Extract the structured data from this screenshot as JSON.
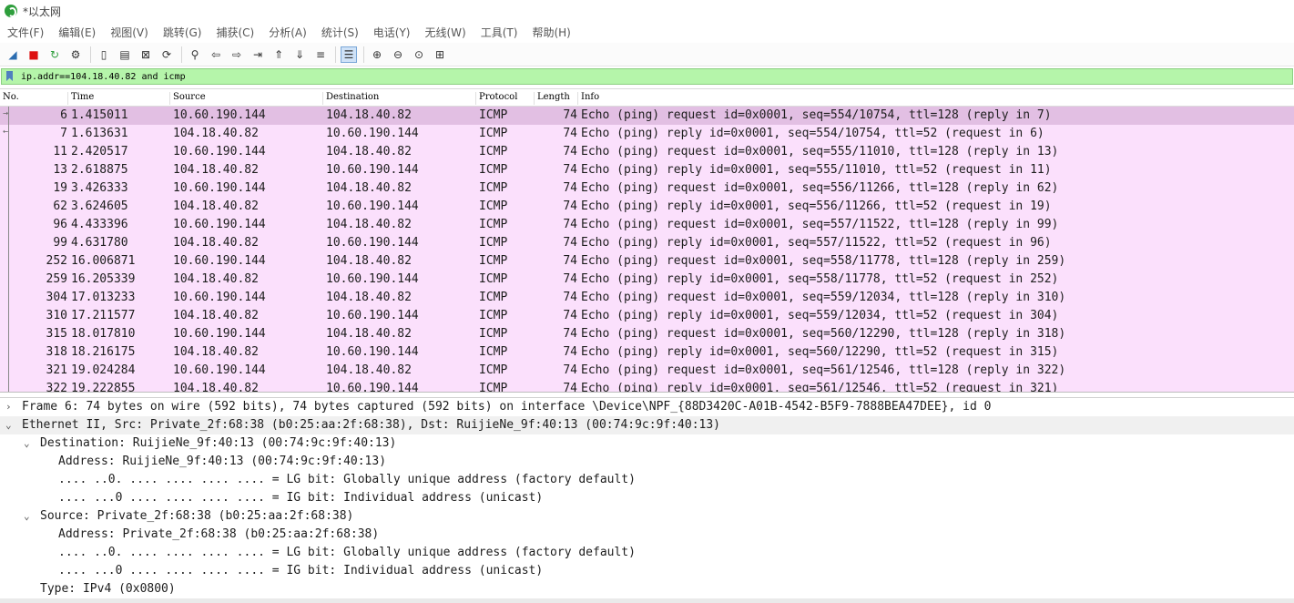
{
  "window": {
    "title": "*以太网"
  },
  "menubar": [
    "文件(F)",
    "编辑(E)",
    "视图(V)",
    "跳转(G)",
    "捕获(C)",
    "分析(A)",
    "统计(S)",
    "电话(Y)",
    "无线(W)",
    "工具(T)",
    "帮助(H)"
  ],
  "toolbar": {
    "icons": [
      "shark-fin-start-icon",
      "stop-icon",
      "restart-icon",
      "options-gear-icon",
      "open-file-icon",
      "save-file-icon",
      "close-file-icon",
      "reload-icon",
      "find-icon",
      "back-arrow-icon",
      "forward-arrow-icon",
      "go-to-packet-icon",
      "first-packet-icon",
      "last-packet-icon",
      "auto-scroll-icon",
      "colorize-icon",
      "zoom-in-icon",
      "zoom-out-icon",
      "zoom-normal-icon",
      "resize-columns-icon"
    ]
  },
  "filter": {
    "value": "ip.addr==104.18.40.82 and icmp"
  },
  "packet_list": {
    "columns": [
      "No.",
      "Time",
      "Source",
      "Destination",
      "Protocol",
      "Length",
      "Info"
    ],
    "rows": [
      {
        "no": "6",
        "time": "1.415011",
        "source": "10.60.190.144",
        "destination": "104.18.40.82",
        "protocol": "ICMP",
        "length": "74",
        "info": "Echo (ping) request  id=0x0001, seq=554/10754, ttl=128 (reply in 7)",
        "selected": true,
        "rel": "→"
      },
      {
        "no": "7",
        "time": "1.613631",
        "source": "104.18.40.82",
        "destination": "10.60.190.144",
        "protocol": "ICMP",
        "length": "74",
        "info": "Echo (ping) reply    id=0x0001, seq=554/10754, ttl=52 (request in 6)",
        "selected": false,
        "rel": "←"
      },
      {
        "no": "11",
        "time": "2.420517",
        "source": "10.60.190.144",
        "destination": "104.18.40.82",
        "protocol": "ICMP",
        "length": "74",
        "info": "Echo (ping) request  id=0x0001, seq=555/11010, ttl=128 (reply in 13)",
        "selected": false,
        "rel": ""
      },
      {
        "no": "13",
        "time": "2.618875",
        "source": "104.18.40.82",
        "destination": "10.60.190.144",
        "protocol": "ICMP",
        "length": "74",
        "info": "Echo (ping) reply    id=0x0001, seq=555/11010, ttl=52 (request in 11)",
        "selected": false,
        "rel": ""
      },
      {
        "no": "19",
        "time": "3.426333",
        "source": "10.60.190.144",
        "destination": "104.18.40.82",
        "protocol": "ICMP",
        "length": "74",
        "info": "Echo (ping) request  id=0x0001, seq=556/11266, ttl=128 (reply in 62)",
        "selected": false,
        "rel": ""
      },
      {
        "no": "62",
        "time": "3.624605",
        "source": "104.18.40.82",
        "destination": "10.60.190.144",
        "protocol": "ICMP",
        "length": "74",
        "info": "Echo (ping) reply    id=0x0001, seq=556/11266, ttl=52 (request in 19)",
        "selected": false,
        "rel": ""
      },
      {
        "no": "96",
        "time": "4.433396",
        "source": "10.60.190.144",
        "destination": "104.18.40.82",
        "protocol": "ICMP",
        "length": "74",
        "info": "Echo (ping) request  id=0x0001, seq=557/11522, ttl=128 (reply in 99)",
        "selected": false,
        "rel": ""
      },
      {
        "no": "99",
        "time": "4.631780",
        "source": "104.18.40.82",
        "destination": "10.60.190.144",
        "protocol": "ICMP",
        "length": "74",
        "info": "Echo (ping) reply    id=0x0001, seq=557/11522, ttl=52 (request in 96)",
        "selected": false,
        "rel": ""
      },
      {
        "no": "252",
        "time": "16.006871",
        "source": "10.60.190.144",
        "destination": "104.18.40.82",
        "protocol": "ICMP",
        "length": "74",
        "info": "Echo (ping) request  id=0x0001, seq=558/11778, ttl=128 (reply in 259)",
        "selected": false,
        "rel": ""
      },
      {
        "no": "259",
        "time": "16.205339",
        "source": "104.18.40.82",
        "destination": "10.60.190.144",
        "protocol": "ICMP",
        "length": "74",
        "info": "Echo (ping) reply    id=0x0001, seq=558/11778, ttl=52 (request in 252)",
        "selected": false,
        "rel": ""
      },
      {
        "no": "304",
        "time": "17.013233",
        "source": "10.60.190.144",
        "destination": "104.18.40.82",
        "protocol": "ICMP",
        "length": "74",
        "info": "Echo (ping) request  id=0x0001, seq=559/12034, ttl=128 (reply in 310)",
        "selected": false,
        "rel": ""
      },
      {
        "no": "310",
        "time": "17.211577",
        "source": "104.18.40.82",
        "destination": "10.60.190.144",
        "protocol": "ICMP",
        "length": "74",
        "info": "Echo (ping) reply    id=0x0001, seq=559/12034, ttl=52 (request in 304)",
        "selected": false,
        "rel": ""
      },
      {
        "no": "315",
        "time": "18.017810",
        "source": "10.60.190.144",
        "destination": "104.18.40.82",
        "protocol": "ICMP",
        "length": "74",
        "info": "Echo (ping) request  id=0x0001, seq=560/12290, ttl=128 (reply in 318)",
        "selected": false,
        "rel": ""
      },
      {
        "no": "318",
        "time": "18.216175",
        "source": "104.18.40.82",
        "destination": "10.60.190.144",
        "protocol": "ICMP",
        "length": "74",
        "info": "Echo (ping) reply    id=0x0001, seq=560/12290, ttl=52 (request in 315)",
        "selected": false,
        "rel": ""
      },
      {
        "no": "321",
        "time": "19.024284",
        "source": "10.60.190.144",
        "destination": "104.18.40.82",
        "protocol": "ICMP",
        "length": "74",
        "info": "Echo (ping) request  id=0x0001, seq=561/12546, ttl=128 (reply in 322)",
        "selected": false,
        "rel": ""
      },
      {
        "no": "322",
        "time": "19.222855",
        "source": "104.18.40.82",
        "destination": "10.60.190.144",
        "protocol": "ICMP",
        "length": "74",
        "info": "Echo (ping) reply    id=0x0001, seq=561/12546, ttl=52 (request in 321)",
        "selected": false,
        "rel": ""
      }
    ]
  },
  "details": {
    "rows": [
      {
        "level": 0,
        "expander": "›",
        "text": "Frame 6: 74 bytes on wire (592 bits), 74 bytes captured (592 bits) on interface \\Device\\NPF_{88D3420C-A01B-4542-B5F9-7888BEA47DEE}, id 0",
        "highlight": false
      },
      {
        "level": 0,
        "expander": "⌄",
        "text": "Ethernet II, Src: Private_2f:68:38 (b0:25:aa:2f:68:38), Dst: RuijieNe_9f:40:13 (00:74:9c:9f:40:13)",
        "highlight": true
      },
      {
        "level": 1,
        "expander": "⌄",
        "text": "Destination: RuijieNe_9f:40:13 (00:74:9c:9f:40:13)",
        "highlight": false
      },
      {
        "level": 2,
        "expander": "",
        "text": "Address: RuijieNe_9f:40:13 (00:74:9c:9f:40:13)",
        "highlight": false
      },
      {
        "level": 2,
        "expander": "",
        "text": ".... ..0. .... .... .... .... = LG bit: Globally unique address (factory default)",
        "highlight": false
      },
      {
        "level": 2,
        "expander": "",
        "text": ".... ...0 .... .... .... .... = IG bit: Individual address (unicast)",
        "highlight": false
      },
      {
        "level": 1,
        "expander": "⌄",
        "text": "Source: Private_2f:68:38 (b0:25:aa:2f:68:38)",
        "highlight": false
      },
      {
        "level": 2,
        "expander": "",
        "text": "Address: Private_2f:68:38 (b0:25:aa:2f:68:38)",
        "highlight": false
      },
      {
        "level": 2,
        "expander": "",
        "text": ".... ..0. .... .... .... .... = LG bit: Globally unique address (factory default)",
        "highlight": false
      },
      {
        "level": 2,
        "expander": "",
        "text": ".... ...0 .... .... .... .... = IG bit: Individual address (unicast)",
        "highlight": false
      },
      {
        "level": 1,
        "expander": "",
        "text": "Type: IPv4 (0x0800)",
        "highlight": false
      }
    ]
  },
  "colors": {
    "row_bg": "#fbe0fc",
    "row_selected": "#e2bfe3",
    "filter_bg": "#b5f5aa"
  }
}
